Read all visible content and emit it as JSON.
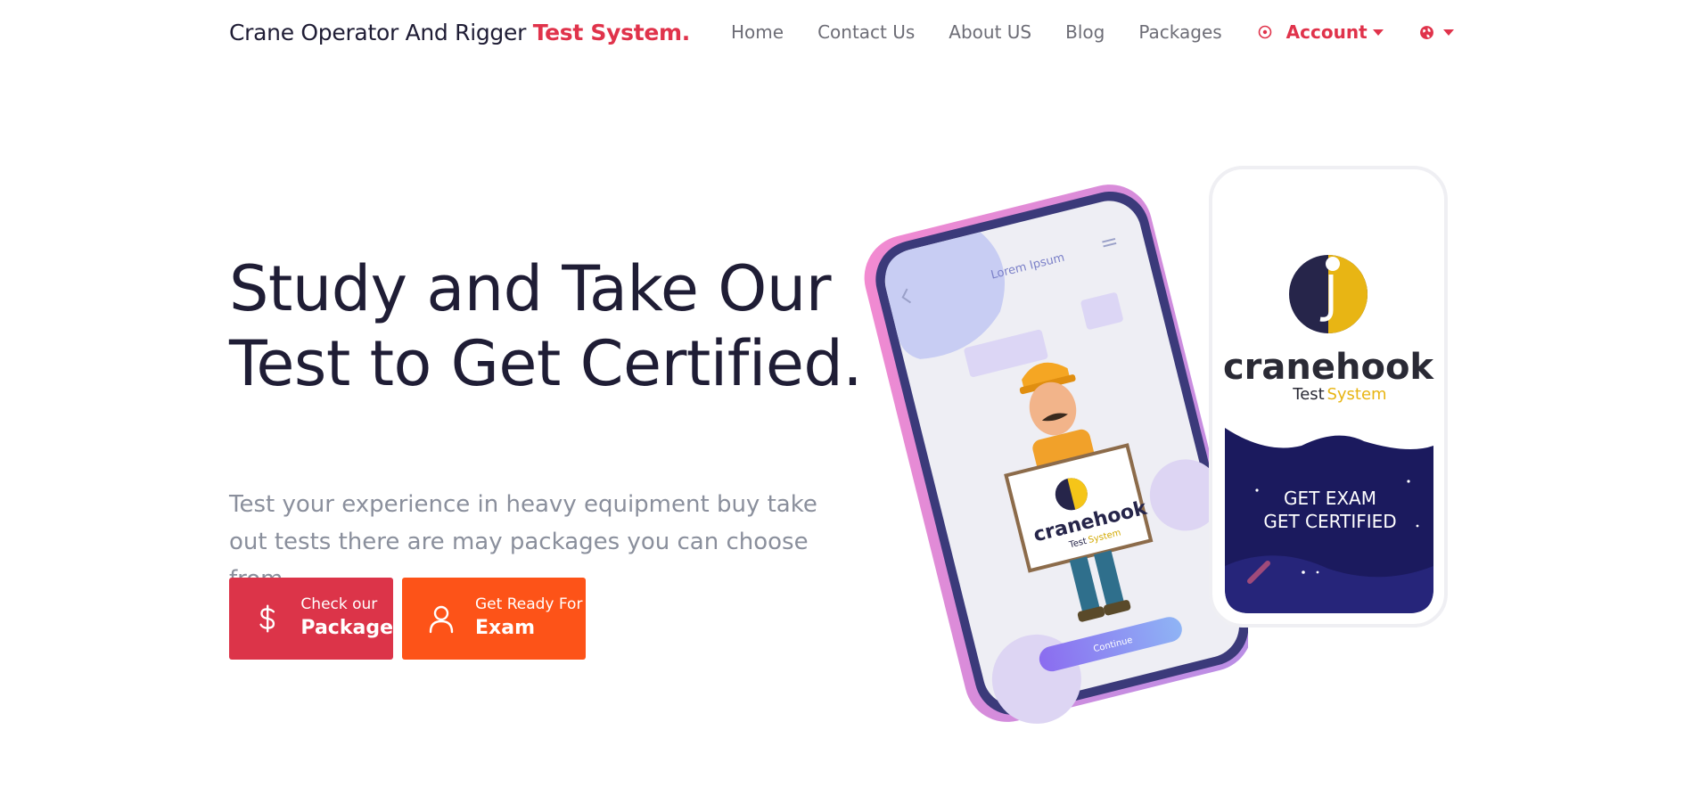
{
  "navbar": {
    "brand_prefix": "Crane Operator And Rigger ",
    "brand_accent": "Test System.",
    "links": [
      {
        "label": "Home"
      },
      {
        "label": "Contact Us"
      },
      {
        "label": "About US"
      },
      {
        "label": "Blog"
      },
      {
        "label": "Packages"
      }
    ],
    "account_label": "Account",
    "icons": {
      "account": "target-icon",
      "language": "globe-icon"
    }
  },
  "hero": {
    "title": "Study and Take Our Test to Get Certified.",
    "subtitle": "Test your experience in heavy equipment buy take out tests there are may packages you can choose from"
  },
  "buttons": {
    "package": {
      "small": "Check our",
      "big": "Package",
      "icon": "dollar-icon"
    },
    "exam": {
      "small": "Get Ready For",
      "big": "Exam",
      "icon": "user-icon"
    }
  },
  "phones": {
    "left_screen_title": "Lorem Ipsum",
    "left_logo_name": "cranehook",
    "left_logo_sub_a": "Test",
    "left_logo_sub_b": "System",
    "left_button": "Continue",
    "right_logo_name": "cranehook",
    "right_logo_sub_a": "Test",
    "right_logo_sub_b": "System",
    "right_line1": "GET EXAM",
    "right_line2": "GET CERTIFIED"
  },
  "colors": {
    "accent_red": "#e0334b",
    "button_red": "#dc3449",
    "button_orange": "#fd5318",
    "navy": "#1b1a5e",
    "text_dark": "#1f1d35",
    "text_muted": "#8a8f9c"
  }
}
